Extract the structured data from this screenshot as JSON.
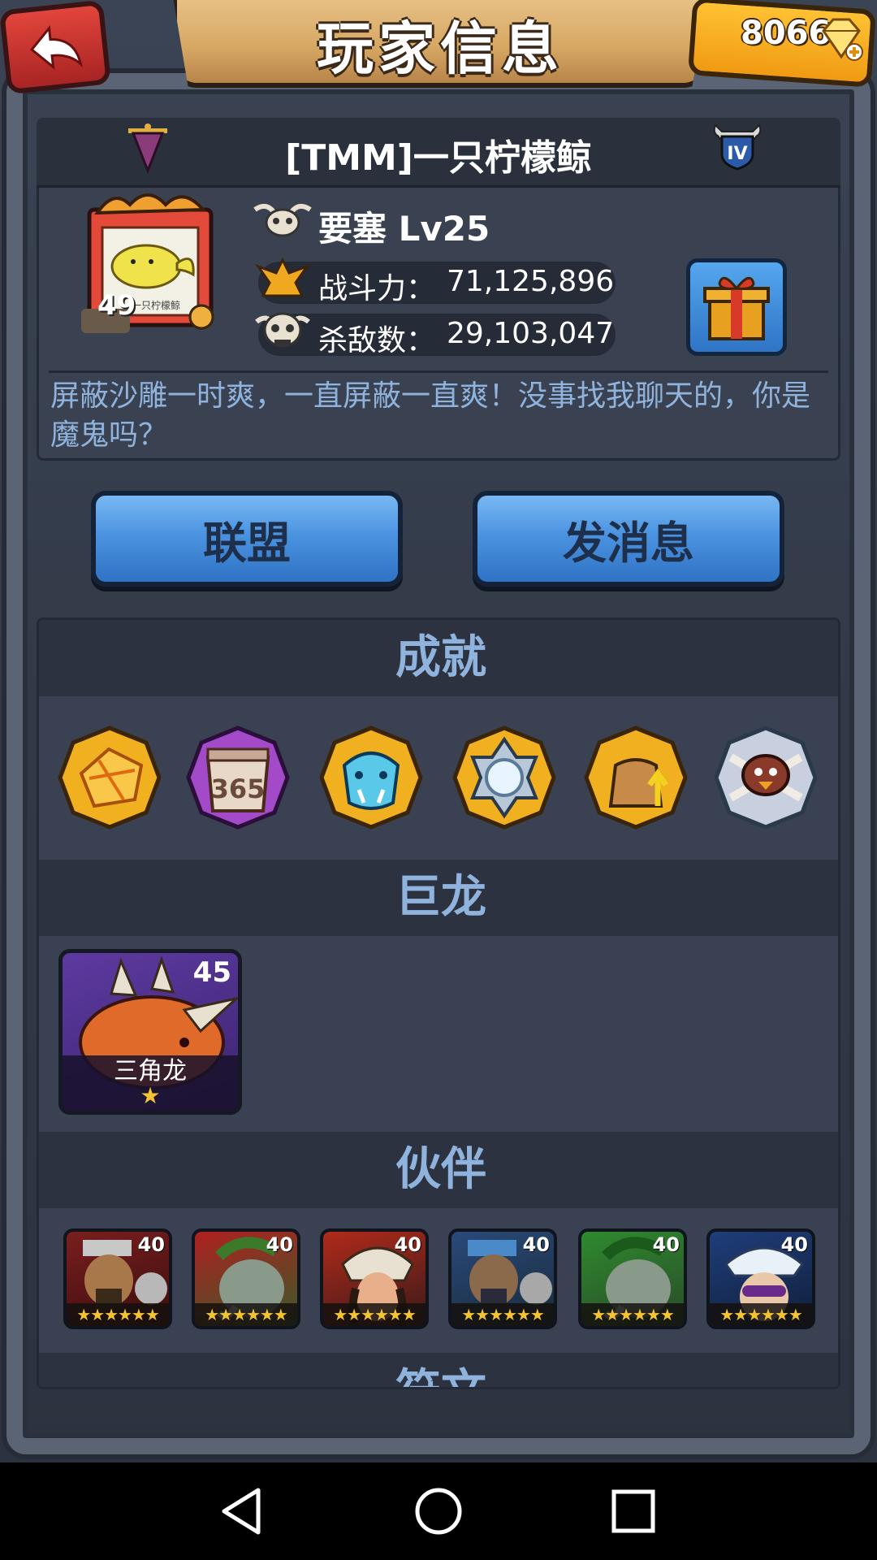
{
  "header": {
    "title": "玩家信息",
    "gems": "8066"
  },
  "profile": {
    "name": "[TMM]一只柠檬鲸",
    "rank_roman": "IV",
    "avatar_level": "49",
    "avatar_caption": "一只柠檬鲸",
    "rank_title": "要塞 Lv25",
    "power_label": "战斗力：",
    "power_value": "71,125,896",
    "kills_label": "杀敌数：",
    "kills_value": "29,103,047",
    "motto": "屏蔽沙雕一时爽，一直屏蔽一直爽！没事找我聊天的，你是魔鬼吗？"
  },
  "actions": {
    "alliance": "联盟",
    "message": "发消息"
  },
  "sections": {
    "achievements": "成就",
    "dragons": "巨龙",
    "partners": "伙伴",
    "next_partial": "符文"
  },
  "achievements": [
    {
      "icon": "gold-crystal-icon"
    },
    {
      "icon": "calendar-365-icon",
      "text": "365"
    },
    {
      "icon": "frost-beast-icon"
    },
    {
      "icon": "silver-gear-icon"
    },
    {
      "icon": "upgrade-bag-icon"
    },
    {
      "icon": "bird-crossed-bones-icon"
    }
  ],
  "dragon": {
    "name": "三角龙",
    "level": "45",
    "stars": "★"
  },
  "partners": [
    {
      "level": "40",
      "stars": "★★★★★★",
      "color": "#7a1e1e"
    },
    {
      "level": "40",
      "stars": "★★★★★★",
      "color": "#9a2020"
    },
    {
      "level": "40",
      "stars": "★★★★★★",
      "color": "#a52a1a"
    },
    {
      "level": "40",
      "stars": "★★★★★★",
      "color": "#2a4a7a"
    },
    {
      "level": "40",
      "stars": "★★★★★★",
      "color": "#2e7a2e"
    },
    {
      "level": "40",
      "stars": "★★★★★★",
      "color": "#1f3d7a"
    }
  ],
  "colors": {
    "accent_text": "#8fb3dc",
    "button_blue": "#4b93e0",
    "gold": "#f4c432"
  }
}
